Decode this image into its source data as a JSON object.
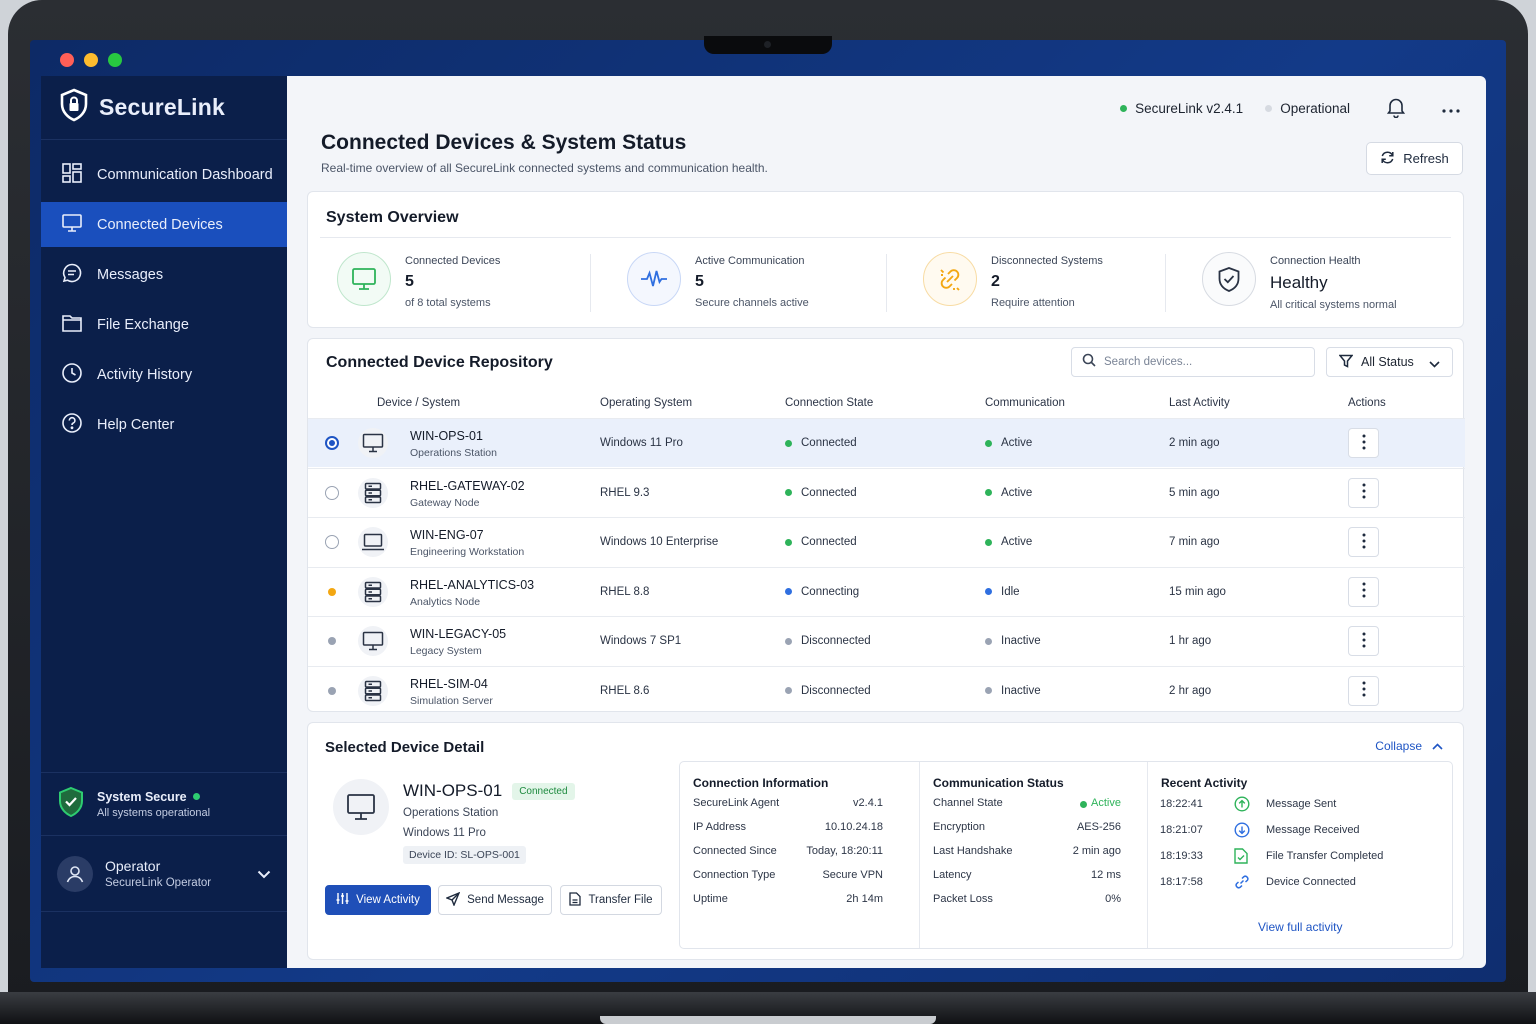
{
  "app": {
    "brand": "SecureLink",
    "version_label": "SecureLink  v2.4.1",
    "status": "Operational"
  },
  "colors": {
    "primary": "#1f55c4",
    "sidebar": "#0b1f4a",
    "green": "#2eb35a",
    "blue": "#2f6fe0",
    "gray": "#9aa3b3",
    "amber": "#f3a712"
  },
  "nav": [
    {
      "label": "Communication Dashboard",
      "icon": "dashboard-icon"
    },
    {
      "label": "Connected Devices",
      "icon": "monitor-icon",
      "active": true
    },
    {
      "label": "Messages",
      "icon": "message-icon"
    },
    {
      "label": "File Exchange",
      "icon": "folder-icon"
    },
    {
      "label": "Activity History",
      "icon": "clock-icon"
    },
    {
      "label": "Help Center",
      "icon": "help-icon"
    }
  ],
  "system_secure": {
    "title": "System Secure",
    "subtitle": "All systems operational"
  },
  "operator": {
    "name": "Operator",
    "role": "SecureLink Operator"
  },
  "page": {
    "title": "Connected Devices & System Status",
    "subtitle": "Real-time overview of all SecureLink connected systems and communication health.",
    "refresh": "Refresh"
  },
  "overview": {
    "title": "System Overview",
    "stats": [
      {
        "label": "Connected Devices",
        "value": "5",
        "sub": "of 8 total systems",
        "icon": "monitor-icon"
      },
      {
        "label": "Active Communication",
        "value": "5",
        "sub": "Secure channels active",
        "icon": "pulse-icon"
      },
      {
        "label": "Disconnected Systems",
        "value": "2",
        "sub": "Require attention",
        "icon": "broken-link-icon"
      },
      {
        "label": "Connection Health",
        "value": "Healthy",
        "sub": "All critical systems normal",
        "icon": "shield-check-icon"
      }
    ]
  },
  "repo": {
    "title": "Connected Device Repository",
    "search_placeholder": "Search devices...",
    "filter": "All Status",
    "columns": [
      "Device / System",
      "Operating System",
      "Connection State",
      "Communication",
      "Last Activity",
      "Actions"
    ],
    "rows": [
      {
        "name": "WIN-OPS-01",
        "role": "Operations Station",
        "os": "Windows 11 Pro",
        "state": "Connected",
        "comm": "Active",
        "last": "2 min ago",
        "type": "monitor",
        "selected": true,
        "marker": "radio-on"
      },
      {
        "name": "RHEL-GATEWAY-02",
        "role": "Gateway Node",
        "os": "RHEL  9.3",
        "state": "Connected",
        "comm": "Active",
        "last": "5 min ago",
        "type": "server",
        "marker": "radio"
      },
      {
        "name": "WIN-ENG-07",
        "role": "Engineering Workstation",
        "os": "Windows 10 Enterprise",
        "state": "Connected",
        "comm": "Active",
        "last": "7 min ago",
        "type": "laptop",
        "marker": "radio"
      },
      {
        "name": "RHEL-ANALYTICS-03",
        "role": "Analytics Node",
        "os": "RHEL  8.8",
        "state": "Connecting",
        "comm": "Idle",
        "last": "15 min ago",
        "type": "server",
        "marker": "amber"
      },
      {
        "name": "WIN-LEGACY-05",
        "role": "Legacy System",
        "os": "Windows 7 SP1",
        "state": "Disconnected",
        "comm": "Inactive",
        "last": "1 hr ago",
        "type": "monitor",
        "marker": "gray"
      },
      {
        "name": "RHEL-SIM-04",
        "role": "Simulation Server",
        "os": "RHEL  8.6",
        "state": "Disconnected",
        "comm": "Inactive",
        "last": "2 hr ago",
        "type": "server",
        "marker": "gray"
      }
    ]
  },
  "detail": {
    "title": "Selected Device Detail",
    "collapse": "Collapse",
    "name": "WIN-OPS-01",
    "badge": "Connected",
    "role": "Operations Station",
    "os": "Windows 11 Pro",
    "device_id": "Device ID: SL-OPS-001",
    "buttons": {
      "view": "View Activity",
      "send": "Send Message",
      "transfer": "Transfer File"
    },
    "connection": {
      "title": "Connection Information",
      "items": [
        {
          "k": "SecureLink Agent",
          "v": "v2.4.1"
        },
        {
          "k": "IP Address",
          "v": "10.10.24.18"
        },
        {
          "k": "Connected Since",
          "v": "Today, 18:20:11"
        },
        {
          "k": "Connection Type",
          "v": "Secure VPN"
        },
        {
          "k": "Uptime",
          "v": "2h 14m"
        }
      ]
    },
    "communication": {
      "title": "Communication Status",
      "items": [
        {
          "k": "Channel State",
          "v": "Active"
        },
        {
          "k": "Encryption",
          "v": "AES-256"
        },
        {
          "k": "Last Handshake",
          "v": "2 min ago"
        },
        {
          "k": "Latency",
          "v": "12 ms"
        },
        {
          "k": "Packet Loss",
          "v": "0%"
        }
      ]
    },
    "activity": {
      "title": "Recent Activity",
      "items": [
        {
          "t": "18:22:41",
          "text": "Message Sent",
          "icon": "arrow-up-circle-icon"
        },
        {
          "t": "18:21:07",
          "text": "Message Received",
          "icon": "arrow-down-circle-icon"
        },
        {
          "t": "18:19:33",
          "text": "File Transfer Completed",
          "icon": "file-check-icon"
        },
        {
          "t": "18:17:58",
          "text": "Device Connected",
          "icon": "link-icon"
        }
      ],
      "view_full": "View full activity"
    }
  }
}
